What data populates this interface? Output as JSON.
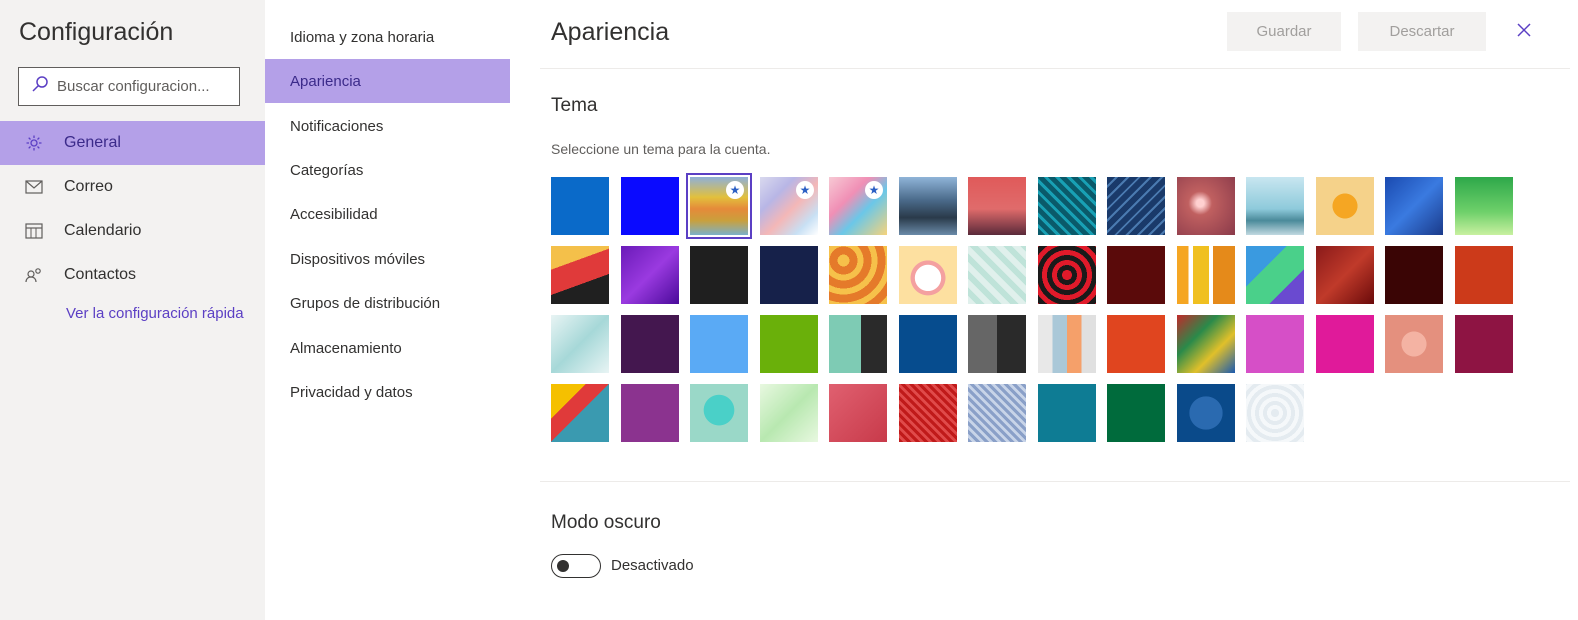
{
  "settings": {
    "title": "Configuración",
    "search_placeholder": "Buscar configuracion...",
    "nav": [
      {
        "label": "General",
        "icon": "gear-icon",
        "active": true
      },
      {
        "label": "Correo",
        "icon": "mail-icon",
        "active": false
      },
      {
        "label": "Calendario",
        "icon": "calendar-icon",
        "active": false
      },
      {
        "label": "Contactos",
        "icon": "contacts-icon",
        "active": false
      }
    ],
    "quick_settings_link": "Ver la configuración rápida"
  },
  "subnav": [
    {
      "label": "Idioma y zona horaria",
      "active": false
    },
    {
      "label": "Apariencia",
      "active": true
    },
    {
      "label": "Notificaciones",
      "active": false
    },
    {
      "label": "Categorías",
      "active": false
    },
    {
      "label": "Accesibilidad",
      "active": false
    },
    {
      "label": "Dispositivos móviles",
      "active": false
    },
    {
      "label": "Grupos de distribución",
      "active": false
    },
    {
      "label": "Almacenamiento",
      "active": false
    },
    {
      "label": "Privacidad y datos",
      "active": false
    }
  ],
  "page": {
    "title": "Apariencia",
    "save_label": "Guardar",
    "discard_label": "Descartar",
    "theme": {
      "heading": "Tema",
      "description": "Seleccione un tema para la cuenta.",
      "tiles": [
        {
          "bg": "#0a6ac9"
        },
        {
          "bg": "#0a0aff"
        },
        {
          "bg": "linear-gradient(180deg,#8fb0d8 0%,#e2c03c 35%,#e58a3a 55%,#c9a03c 75%,#7cb0c8 100%)",
          "star": true,
          "selected": true
        },
        {
          "bg": "linear-gradient(135deg,#d9d9ee 0%,#b8b6e6 30%,#f4b7b7 55%,#c8e0f4 80%,#ffffff 100%)",
          "star": true
        },
        {
          "bg": "linear-gradient(135deg,#f7c9d4 0%,#f08fb5 35%,#6bc7e8 60%,#f6d37b 100%)",
          "star": true
        },
        {
          "bg": "linear-gradient(180deg,#8fb4d8 0%,#4a6a8a 40%,#2a3a4a 70%,#6a8aa8 100%)"
        },
        {
          "bg": "linear-gradient(180deg,#e05a5a 0%,#e06b6b 55%,#5a2a3a 100%)"
        },
        {
          "bg": "repeating-linear-gradient(45deg,#0a5a6a 0 5px,#18a0b4 5px 8px)"
        },
        {
          "bg": "repeating-linear-gradient(135deg,#1a3a6a 0 6px,#4a7ab0 6px 8px)"
        },
        {
          "bg": "radial-gradient(circle at 40% 45%,#ffd0d0 0 8%,#c06060 25%,#8a3a4a 100%)"
        },
        {
          "bg": "linear-gradient(180deg,#c8e6f0 0%,#8ecadb 55%,#4a8a9a 75%,#c0d8e0 100%)"
        },
        {
          "bg": "radial-gradient(circle at 50% 50%,#f5a623 0 30%,#f5d28a 31%)"
        },
        {
          "bg": "linear-gradient(135deg,#1a4ab0 0%,#3a7ae0 50%,#1a3a8a 100%)"
        },
        {
          "bg": "linear-gradient(180deg,#2ea84a 0%,#6ed06a 60%,#c8f0a0 100%)"
        },
        {
          "bg": "linear-gradient(160deg,#f4c04a 0 30%,#e03a3a 30% 62%,#202020 62%)"
        },
        {
          "bg": "linear-gradient(135deg,#6a1ab8 0%,#9a3ae0 50%,#4a0a9a 100%)"
        },
        {
          "bg": "#1f1f1f"
        },
        {
          "bg": "#16214a"
        },
        {
          "bg": "repeating-radial-gradient(circle at 25% 25%,#f6c14a 0 6px,#e57a2a 6px 14px)"
        },
        {
          "bg": "radial-gradient(circle at 50% 55%,#ffffff 0 30%,#f4a0a0 31% 40%,#fde0a0 41%)"
        },
        {
          "bg": "repeating-linear-gradient(45deg,#e0f0ec 0 6px,#bfe3d9 6px 12px)"
        },
        {
          "bg": "repeating-radial-gradient(circle at 50% 50%,#e01a2a 0 5px,#1a1a1a 5px 10px)"
        },
        {
          "bg": "#5a0a0a"
        },
        {
          "bg": "linear-gradient(90deg,#f5a623 0 20%,#fff 20% 28%,#f0c020 28% 55%,#fff 55% 62%,#e58a1a 62%)"
        },
        {
          "bg": "linear-gradient(135deg,#3a9ae0 0 35%,#4ad08a 35% 70%,#6a4ad0 70%)"
        },
        {
          "bg": "linear-gradient(135deg,#8a1a1a 0%,#c03a2a 50%,#6a0a0a 100%)"
        },
        {
          "bg": "#3a0505"
        },
        {
          "bg": "#cc3a1a"
        },
        {
          "bg": "linear-gradient(135deg,#e8f4f4 0%,#a6d8d8 50%,#e8f4f4 100%)"
        },
        {
          "bg": "#44174f"
        },
        {
          "bg": "#5aaaf5"
        },
        {
          "bg": "#6ab00a"
        },
        {
          "bg": "linear-gradient(90deg,#7ecbb4 0 55%,#2a2a2a 55%)"
        },
        {
          "bg": "#064c8e"
        },
        {
          "bg": "linear-gradient(90deg,#666 0 50%,#2a2a2a 50%)"
        },
        {
          "bg": "linear-gradient(90deg,#e8e8e8 0 25%,#aac8d8 25% 50%,#f5a06a 50% 75%,#e0e0e0 75%)"
        },
        {
          "bg": "#e0451f"
        },
        {
          "bg": "linear-gradient(135deg,#c02a2a 0%,#2a8a4a 35%,#e0c02a 65%,#1a5ab0 100%)"
        },
        {
          "bg": "#d64fc7"
        },
        {
          "bg": "#e01a9a"
        },
        {
          "bg": "radial-gradient(circle at 50% 50%,#f4b3a3 0 30%,#e4907e 31%)"
        },
        {
          "bg": "#8e1443"
        },
        {
          "bg": "linear-gradient(135deg,#f5c000 0 30%,#e03a3a 30% 50%,#3a9ab0 50%)"
        },
        {
          "bg": "#8b338f"
        },
        {
          "bg": "radial-gradient(circle at 50% 45%,#4ad0c8 0 35%,#9ad8c8 36%)"
        },
        {
          "bg": "linear-gradient(135deg,#e8f8e0 0%,#b8e8b0 50%,#e8f8e0 100%)"
        },
        {
          "bg": "linear-gradient(135deg,#e06070 0%,#c83a4a 100%)"
        },
        {
          "bg": "repeating-linear-gradient(45deg,#c01a1a 0 3px,#e04a4a 3px 6px)"
        },
        {
          "bg": "repeating-linear-gradient(45deg,#8aa0c8 0 3px,#c8d4e8 3px 6px)"
        },
        {
          "bg": "#0e7c94"
        },
        {
          "bg": "#006b3c"
        },
        {
          "bg": "radial-gradient(circle at 50% 50%,#2a6ab0 0 40%,#0a4a8a 41%)"
        },
        {
          "bg": "repeating-radial-gradient(circle at 50% 50%,#e4ebf0 0 4px,#f5f8fa 4px 8px)"
        }
      ]
    },
    "dark_mode": {
      "heading": "Modo oscuro",
      "state_label": "Desactivado",
      "enabled": false
    }
  }
}
